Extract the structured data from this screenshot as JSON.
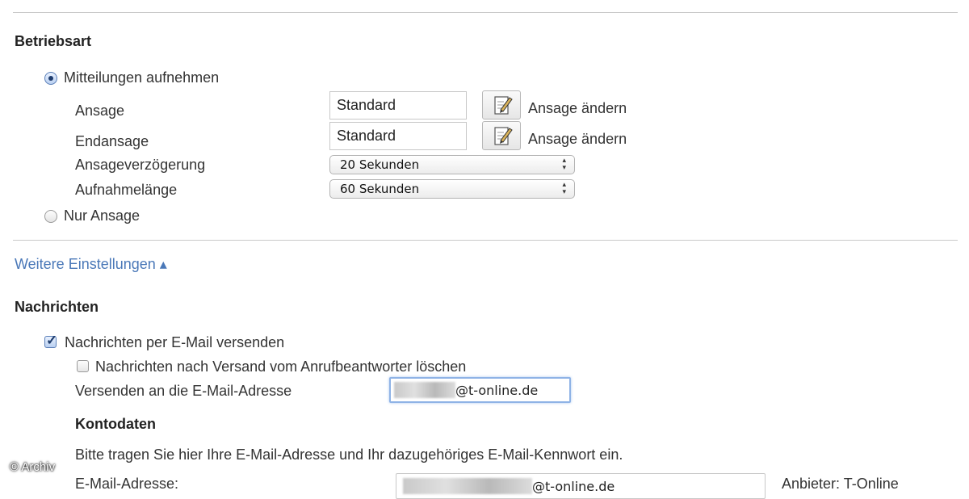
{
  "operating_mode": {
    "heading": "Betriebsart",
    "record_messages": {
      "label": "Mitteilungen aufnehmen",
      "checked": true
    },
    "announcement": {
      "label": "Ansage",
      "value": "Standard",
      "edit_label": "Ansage ändern"
    },
    "end_announcement": {
      "label": "Endansage",
      "value": "Standard",
      "edit_label": "Ansage ändern"
    },
    "announcement_delay": {
      "label": "Ansageverzögerung",
      "value": "20 Sekunden"
    },
    "recording_length": {
      "label": "Aufnahmelänge",
      "value": "60 Sekunden"
    },
    "announcement_only": {
      "label": "Nur Ansage",
      "checked": false
    }
  },
  "more_settings": {
    "label": "Weitere Einstellungen ▴"
  },
  "messages": {
    "heading": "Nachrichten",
    "send_email": {
      "label": "Nachrichten per E-Mail versenden",
      "checked": true
    },
    "delete_after_send": {
      "label": "Nachrichten nach Versand vom Anrufbeantworter löschen",
      "checked": false
    },
    "send_to": {
      "label": "Versenden an die E-Mail-Adresse",
      "value_suffix": "@t-online.de"
    }
  },
  "account": {
    "heading": "Kontodaten",
    "instruction": "Bitte tragen Sie hier Ihre E-Mail-Adresse und Ihr dazugehöriges E-Mail-Kennwort ein.",
    "email_label": "E-Mail-Adresse:",
    "email_value_suffix": "@t-online.de",
    "provider_label": "Anbieter: T-Online"
  },
  "watermark": "© Archiv",
  "icons": {
    "edit": "edit-note-icon",
    "select_arrows": "updown-arrows-icon",
    "collapse": "triangle-up-icon"
  }
}
